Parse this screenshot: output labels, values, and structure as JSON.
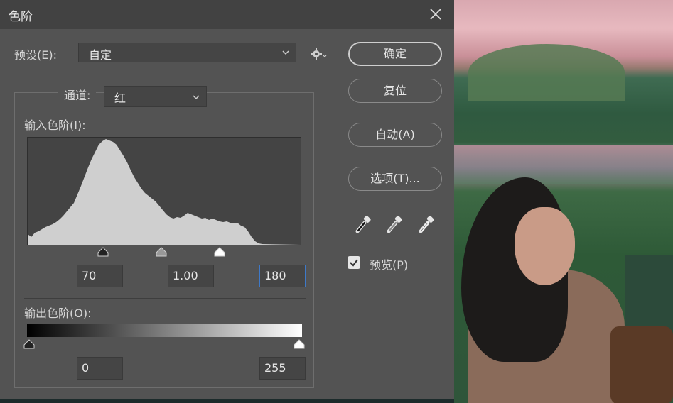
{
  "dialog": {
    "title": "色阶",
    "preset_label": "预设(E):",
    "preset_value": "自定",
    "channel_label": "通道:",
    "channel_value": "红",
    "input_levels_label": "输入色阶(I):",
    "input_black": "70",
    "input_gamma": "1.00",
    "input_white": "180",
    "output_levels_label": "输出色阶(O):",
    "output_black": "0",
    "output_white": "255",
    "buttons": {
      "ok": "确定",
      "reset": "复位",
      "auto": "自动(A)",
      "options": "选项(T)..."
    },
    "preview_label": "预览(P)",
    "preview_checked": true
  },
  "colors": {
    "dialog_bg": "#535353",
    "titlebar_bg": "#424242",
    "histogram_fill": "#cfcfcf",
    "focus_border": "#3e79c8"
  },
  "icons": [
    "close-icon",
    "chevron-down-icon",
    "gear-icon",
    "black-eyedropper-icon",
    "gray-eyedropper-icon",
    "white-eyedropper-icon",
    "checkmark-icon"
  ]
}
